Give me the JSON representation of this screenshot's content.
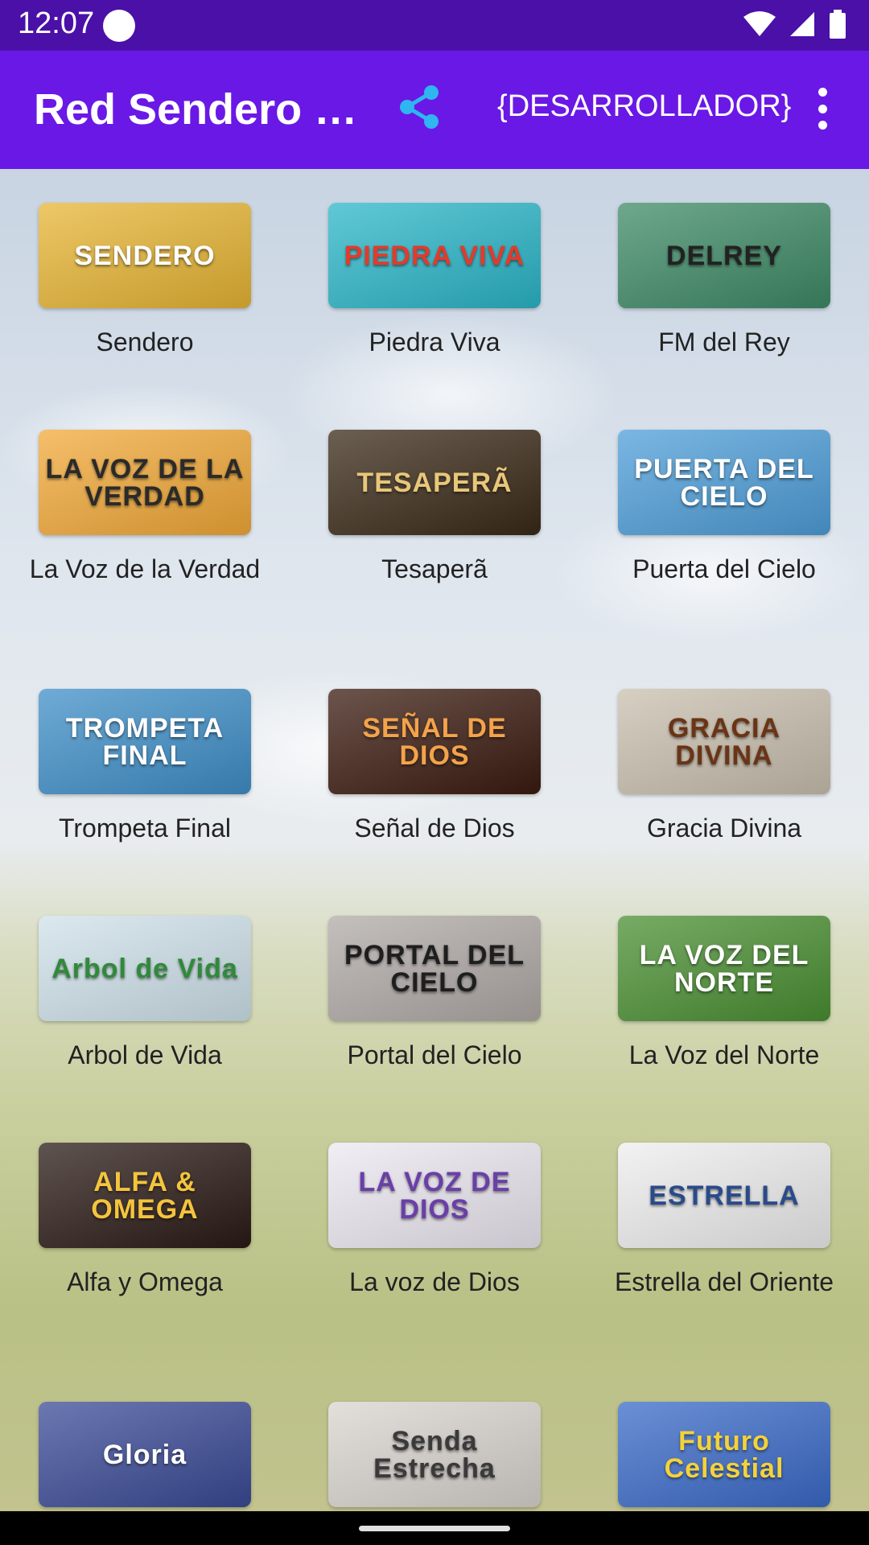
{
  "status_bar": {
    "time": "12:07"
  },
  "app_bar": {
    "title": "Red Sendero C...",
    "developer_label": "{DESARROLLADOR}"
  },
  "stations": [
    {
      "name": "Sendero",
      "logo_text": "SENDERO",
      "bg": "#e7b534",
      "fg": "#ffffff"
    },
    {
      "name": "Piedra Viva",
      "logo_text": "PIEDRA VIVA",
      "bg": "#2bb6c8",
      "fg": "#e33a2b"
    },
    {
      "name": "FM del Rey",
      "logo_text": "DELREY",
      "bg": "#3e8a66",
      "fg": "#222222"
    },
    {
      "name": "La Voz de la Verdad",
      "logo_text": "LA VOZ DE LA VERDAD",
      "bg": "#f2a938",
      "fg": "#2a2a2a"
    },
    {
      "name": "Tesaperã",
      "logo_text": "TESAPERÃ",
      "bg": "#3a2a18",
      "fg": "#e8c77a"
    },
    {
      "name": "Puerta del Cielo",
      "logo_text": "PUERTA DEL CIELO",
      "bg": "#4e9ed9",
      "fg": "#ffffff"
    },
    {
      "name": "Trompeta Final",
      "logo_text": "TROMPETA FINAL",
      "bg": "#3f8fc8",
      "fg": "#ffffff"
    },
    {
      "name": "Señal de Dios",
      "logo_text": "SEÑAL DE DIOS",
      "bg": "#3b1b10",
      "fg": "#f3a34a"
    },
    {
      "name": "Gracia Divina",
      "logo_text": "GRACIA DIVINA",
      "bg": "#c9bfae",
      "fg": "#6a3415"
    },
    {
      "name": "Arbol de Vida",
      "logo_text": "Arbol de Vida",
      "bg": "#cfe2ea",
      "fg": "#2f8a3a"
    },
    {
      "name": "Portal del Cielo",
      "logo_text": "PORTAL DEL CIELO",
      "bg": "#b0aaa6",
      "fg": "#1e1e1e"
    },
    {
      "name": "La Voz del Norte",
      "logo_text": "LA VOZ DEL NORTE",
      "bg": "#4a8f32",
      "fg": "#ffffff"
    },
    {
      "name": "Alfa y Omega",
      "logo_text": "ALFA & OMEGA",
      "bg": "#2a1a16",
      "fg": "#f4c43d"
    },
    {
      "name": "La voz de Dios",
      "logo_text": "LA VOZ DE DIOS",
      "bg": "#ece8f2",
      "fg": "#6a3fa8"
    },
    {
      "name": "Estrella del Oriente",
      "logo_text": "ESTRELLA",
      "bg": "#eeeeee",
      "fg": "#2a4a8a"
    },
    {
      "name": "",
      "logo_text": "Gloria",
      "bg": "#3a4a96",
      "fg": "#ffffff"
    },
    {
      "name": "",
      "logo_text": "Senda Estrecha",
      "bg": "#d9d4cf",
      "fg": "#3a3a3a"
    },
    {
      "name": "",
      "logo_text": "Futuro Celestial",
      "bg": "#3a6ac8",
      "fg": "#f4d23a"
    }
  ]
}
